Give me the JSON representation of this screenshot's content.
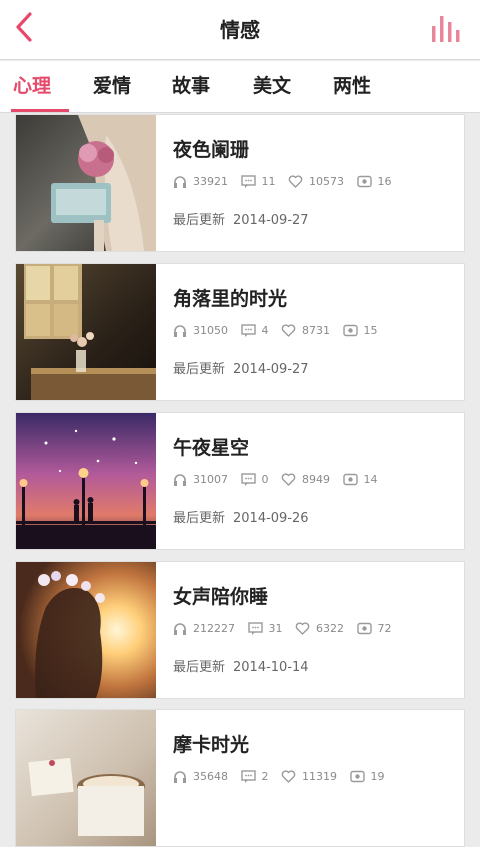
{
  "header": {
    "title": "情感"
  },
  "tabs": [
    {
      "label": "心理",
      "active": true
    },
    {
      "label": "爱情",
      "active": false
    },
    {
      "label": "故事",
      "active": false
    },
    {
      "label": "美文",
      "active": false
    },
    {
      "label": "两性",
      "active": false
    }
  ],
  "colors": {
    "accent": "#e64a6b",
    "bg": "#ebebeb"
  },
  "updated_label": "最后更新",
  "items": [
    {
      "title": "夜色阑珊",
      "plays": "33921",
      "comments": "11",
      "likes": "10573",
      "episodes": "16",
      "updated": "2014-09-27"
    },
    {
      "title": "角落里的时光",
      "plays": "31050",
      "comments": "4",
      "likes": "8731",
      "episodes": "15",
      "updated": "2014-09-27"
    },
    {
      "title": "午夜星空",
      "plays": "31007",
      "comments": "0",
      "likes": "8949",
      "episodes": "14",
      "updated": "2014-09-26"
    },
    {
      "title": "女声陪你睡",
      "plays": "212227",
      "comments": "31",
      "likes": "6322",
      "episodes": "72",
      "updated": "2014-10-14"
    },
    {
      "title": "摩卡时光",
      "plays": "35648",
      "comments": "2",
      "likes": "11319",
      "episodes": "19",
      "updated": ""
    }
  ]
}
